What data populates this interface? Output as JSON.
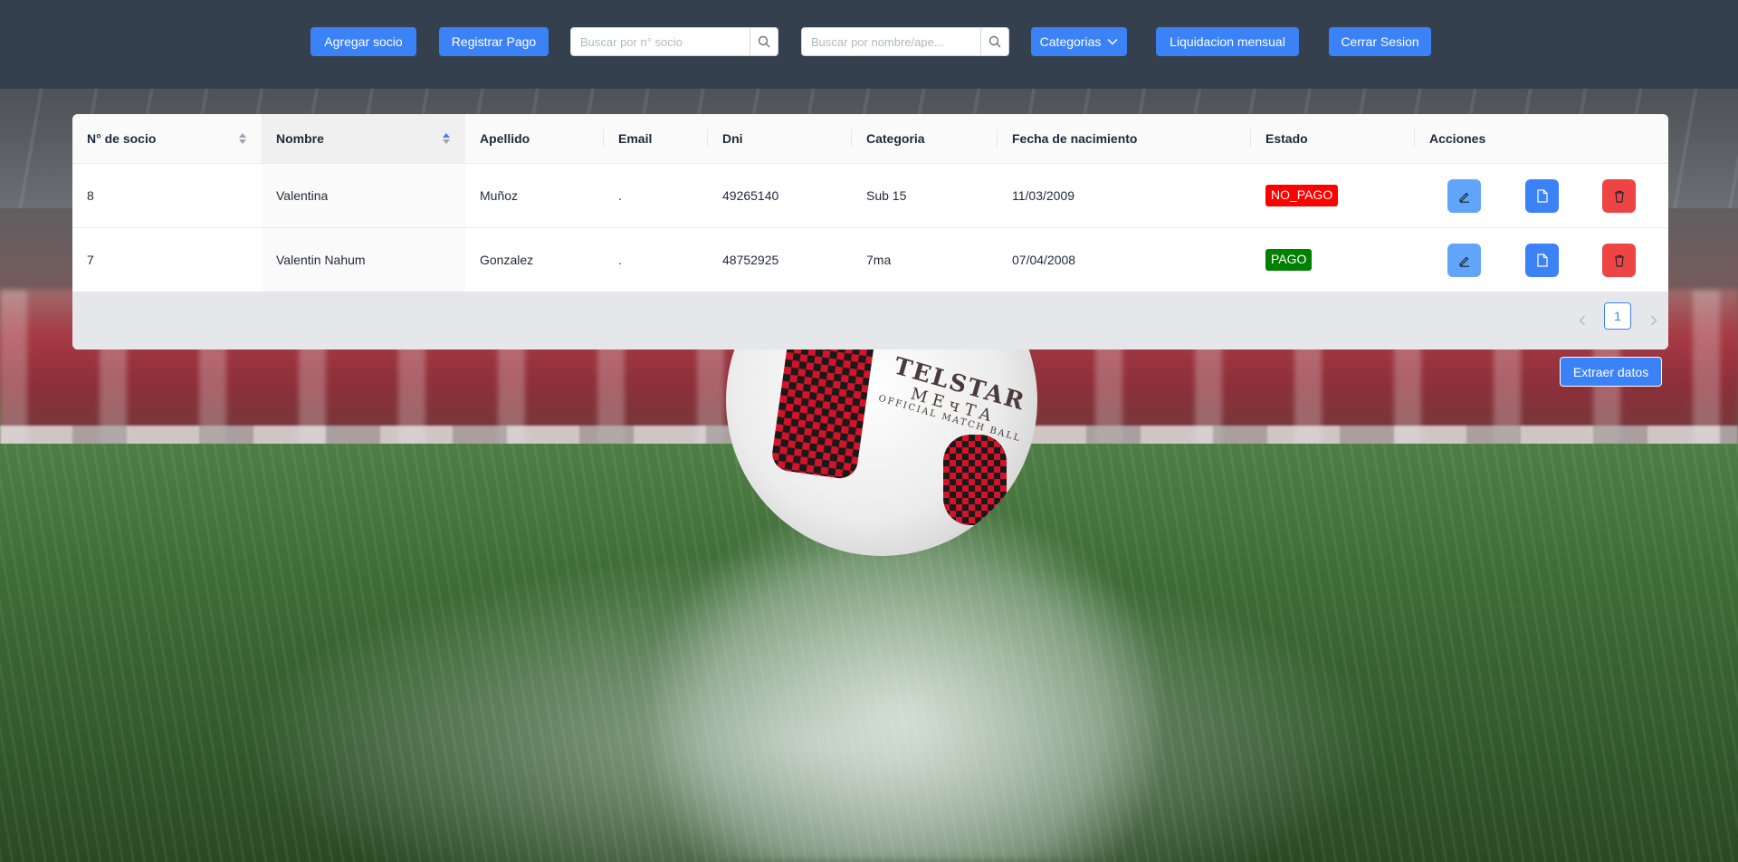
{
  "toolbar": {
    "add_member_label": "Agregar socio",
    "register_payment_label": "Registrar Pago",
    "search_number_placeholder": "Buscar por n° socio",
    "search_name_placeholder": "Buscar por nombre/ape...",
    "categories_label": "Categorias",
    "monthly_settlement_label": "Liquidacion mensual",
    "logout_label": "Cerrar Sesion"
  },
  "table": {
    "columns": [
      "N° de socio",
      "Nombre",
      "Apellido",
      "Email",
      "Dni",
      "Categoria",
      "Fecha de nacimiento",
      "Estado",
      "Acciones"
    ],
    "rows": [
      {
        "numero": "8",
        "nombre": "Valentina",
        "apellido": "Muñoz",
        "email": ".",
        "dni": "49265140",
        "categoria": "Sub 15",
        "fecha": "11/03/2009",
        "estado": "NO_PAGO",
        "estado_color": "#ff0000"
      },
      {
        "numero": "7",
        "nombre": "Valentin Nahum",
        "apellido": "Gonzalez",
        "email": ".",
        "dni": "48752925",
        "categoria": "7ma",
        "fecha": "07/04/2008",
        "estado": "PAGO",
        "estado_color": "#008000"
      }
    ]
  },
  "pagination": {
    "current_page": "1"
  },
  "extract_label": "Extraer datos",
  "background": {
    "ball_text_1": "TELSTAR",
    "ball_text_2": "MEчTA",
    "ball_text_3": "OFFICIAL MATCH BALL"
  },
  "colors": {
    "primary": "#3b82f6",
    "edit_button": "#60a5fa",
    "delete_button": "#ef4444",
    "topbar": "#35404f"
  }
}
